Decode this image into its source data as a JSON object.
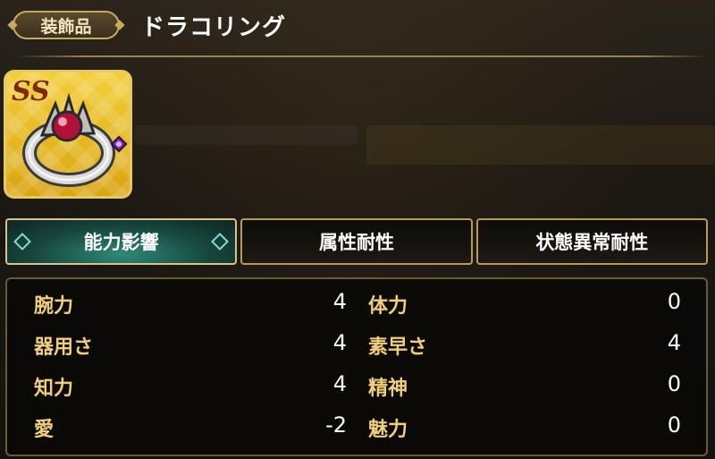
{
  "header": {
    "category": "装飾品",
    "item_name": "ドラコリング"
  },
  "item": {
    "rank": "SS",
    "icon": "dragon-ring-icon",
    "frame_color": "#e8c866"
  },
  "tabs": [
    {
      "label": "能力影響",
      "active": true
    },
    {
      "label": "属性耐性",
      "active": false
    },
    {
      "label": "状態異常耐性",
      "active": false
    }
  ],
  "stats": {
    "left": [
      {
        "label": "腕力",
        "value": "4"
      },
      {
        "label": "器用さ",
        "value": "4"
      },
      {
        "label": "知力",
        "value": "4"
      },
      {
        "label": "愛",
        "value": "-2"
      }
    ],
    "right": [
      {
        "label": "体力",
        "value": "0"
      },
      {
        "label": "素早さ",
        "value": "4"
      },
      {
        "label": "精神",
        "value": "0"
      },
      {
        "label": "魅力",
        "value": "0"
      }
    ]
  },
  "colors": {
    "label": "#f0cf7a",
    "active_tab": "#2f8a78",
    "border": "#b89a58"
  }
}
